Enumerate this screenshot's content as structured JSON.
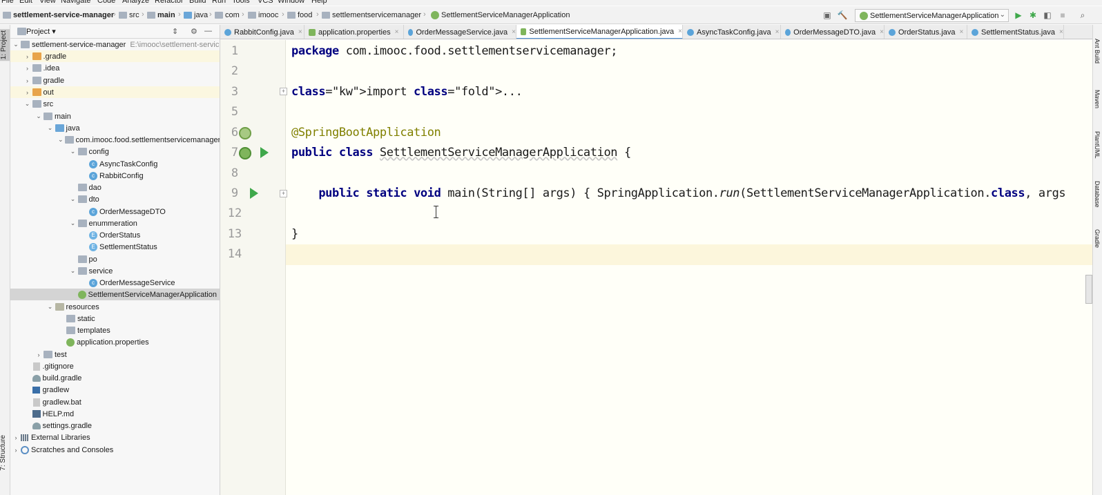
{
  "menu": [
    "File",
    "Edit",
    "View",
    "Navigate",
    "Code",
    "Analyze",
    "Refactor",
    "Build",
    "Run",
    "Tools",
    "VCS",
    "Window",
    "Help"
  ],
  "breadcrumb": [
    "settlement-service-manager",
    "src",
    "main",
    "java",
    "com",
    "imooc",
    "food",
    "settlementservicemanager",
    "SettlementServiceManagerApplication"
  ],
  "toolbar": {
    "run_config": "SettlementServiceManagerApplication"
  },
  "left_tool_tabs": {
    "project": "1: Project",
    "structure": "7: Structure"
  },
  "right_tool_tabs": [
    "Ant Build",
    "Maven",
    "PlantUML",
    "Database",
    "Gradle"
  ],
  "project_panel": {
    "title": "Project",
    "tree": [
      {
        "label": "settlement-service-manager",
        "hint": "E:\\imooc\\settlement-servic",
        "depth": 0,
        "arrow": "down",
        "icon": "module"
      },
      {
        "label": ".gradle",
        "depth": 1,
        "arrow": "right",
        "icon": "folder-orange",
        "hl": true
      },
      {
        "label": ".idea",
        "depth": 1,
        "arrow": "right",
        "icon": "folder"
      },
      {
        "label": "gradle",
        "depth": 1,
        "arrow": "right",
        "icon": "folder"
      },
      {
        "label": "out",
        "depth": 1,
        "arrow": "right",
        "icon": "folder-orange",
        "hl": true
      },
      {
        "label": "src",
        "depth": 1,
        "arrow": "down",
        "icon": "folder"
      },
      {
        "label": "main",
        "depth": 2,
        "arrow": "down",
        "icon": "folder"
      },
      {
        "label": "java",
        "depth": 3,
        "arrow": "down",
        "icon": "folder-blue"
      },
      {
        "label": "com.imooc.food.settlementservicemanager",
        "depth": 4,
        "arrow": "down",
        "icon": "folder"
      },
      {
        "label": "config",
        "depth": 5,
        "arrow": "down",
        "icon": "folder"
      },
      {
        "label": "AsyncTaskConfig",
        "depth": 6,
        "arrow": "",
        "icon": "class"
      },
      {
        "label": "RabbitConfig",
        "depth": 6,
        "arrow": "",
        "icon": "class"
      },
      {
        "label": "dao",
        "depth": 5,
        "arrow": "",
        "icon": "folder"
      },
      {
        "label": "dto",
        "depth": 5,
        "arrow": "down",
        "icon": "folder"
      },
      {
        "label": "OrderMessageDTO",
        "depth": 6,
        "arrow": "",
        "icon": "class"
      },
      {
        "label": "enummeration",
        "depth": 5,
        "arrow": "down",
        "icon": "folder"
      },
      {
        "label": "OrderStatus",
        "depth": 6,
        "arrow": "",
        "icon": "enum"
      },
      {
        "label": "SettlementStatus",
        "depth": 6,
        "arrow": "",
        "icon": "enum"
      },
      {
        "label": "po",
        "depth": 5,
        "arrow": "",
        "icon": "folder"
      },
      {
        "label": "service",
        "depth": 5,
        "arrow": "down",
        "icon": "folder"
      },
      {
        "label": "OrderMessageService",
        "depth": 6,
        "arrow": "",
        "icon": "class"
      },
      {
        "label": "SettlementServiceManagerApplication",
        "depth": 5,
        "arrow": "",
        "icon": "spring",
        "sel": true
      },
      {
        "label": "resources",
        "depth": 3,
        "arrow": "down",
        "icon": "folder-res"
      },
      {
        "label": "static",
        "depth": 4,
        "arrow": "",
        "icon": "folder"
      },
      {
        "label": "templates",
        "depth": 4,
        "arrow": "",
        "icon": "folder"
      },
      {
        "label": "application.properties",
        "depth": 4,
        "arrow": "",
        "icon": "spring"
      },
      {
        "label": "test",
        "depth": 2,
        "arrow": "right",
        "icon": "folder"
      },
      {
        "label": ".gitignore",
        "depth": 1,
        "arrow": "",
        "icon": "file"
      },
      {
        "label": "build.gradle",
        "depth": 1,
        "arrow": "",
        "icon": "gradle"
      },
      {
        "label": "gradlew",
        "depth": 1,
        "arrow": "",
        "icon": "term"
      },
      {
        "label": "gradlew.bat",
        "depth": 1,
        "arrow": "",
        "icon": "file"
      },
      {
        "label": "HELP.md",
        "depth": 1,
        "arrow": "",
        "icon": "md"
      },
      {
        "label": "settings.gradle",
        "depth": 1,
        "arrow": "",
        "icon": "gradle"
      },
      {
        "label": "External Libraries",
        "depth": 0,
        "arrow": "right",
        "icon": "lib"
      },
      {
        "label": "Scratches and Consoles",
        "depth": 0,
        "arrow": "right",
        "icon": "scratch"
      }
    ]
  },
  "tabs": [
    {
      "label": "RabbitConfig.java",
      "icon": "class"
    },
    {
      "label": "application.properties",
      "icon": "spring"
    },
    {
      "label": "OrderMessageService.java",
      "icon": "class"
    },
    {
      "label": "SettlementServiceManagerApplication.java",
      "icon": "spring",
      "active": true
    },
    {
      "label": "AsyncTaskConfig.java",
      "icon": "class"
    },
    {
      "label": "OrderMessageDTO.java",
      "icon": "class"
    },
    {
      "label": "OrderStatus.java",
      "icon": "enum"
    },
    {
      "label": "SettlementStatus.java",
      "icon": "enum"
    }
  ],
  "editor": {
    "lines": [
      {
        "n": "1",
        "code": "package com.imooc.food.settlementservicemanager;"
      },
      {
        "n": "2",
        "code": ""
      },
      {
        "n": "3",
        "code": "import ..."
      },
      {
        "n": "5",
        "code": ""
      },
      {
        "n": "6",
        "code": "@SpringBootApplication"
      },
      {
        "n": "7",
        "code": "public class SettlementServiceManagerApplication {"
      },
      {
        "n": "8",
        "code": ""
      },
      {
        "n": "9",
        "code": "    public static void main(String[] args) { SpringApplication.run(SettlementServiceManagerApplication.class, args"
      },
      {
        "n": "12",
        "code": ""
      },
      {
        "n": "13",
        "code": "}"
      },
      {
        "n": "14",
        "code": ""
      }
    ]
  }
}
